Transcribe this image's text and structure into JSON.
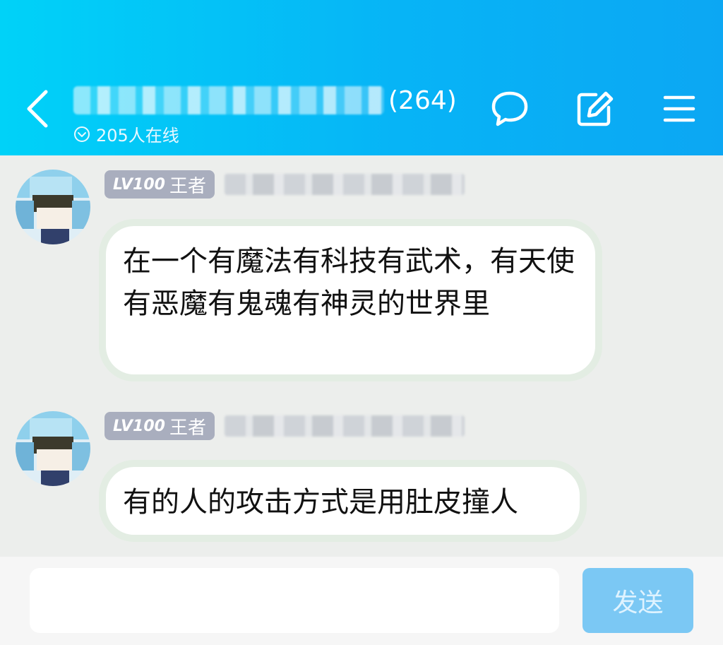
{
  "header": {
    "title_suffix": "(264)",
    "online_text": "205人在线",
    "icons": [
      "back-icon",
      "chat-bubble-icon",
      "edit-icon",
      "menu-icon"
    ]
  },
  "messages": [
    {
      "badge_level": "LV100",
      "badge_title": "王者",
      "text": "在一个有魔法有科技有武术，有天使有恶魔有鬼魂有神灵的世界里"
    },
    {
      "badge_level": "LV100",
      "badge_title": "王者",
      "text": "有的人的攻击方式是用肚皮撞人"
    }
  ],
  "composer": {
    "input_value": "",
    "send_label": "发送"
  },
  "colors": {
    "header_start": "#00d2f8",
    "header_end": "#0ca7f3",
    "badge_bg": "#a9aebe",
    "send_button": "#7bc8f4"
  }
}
